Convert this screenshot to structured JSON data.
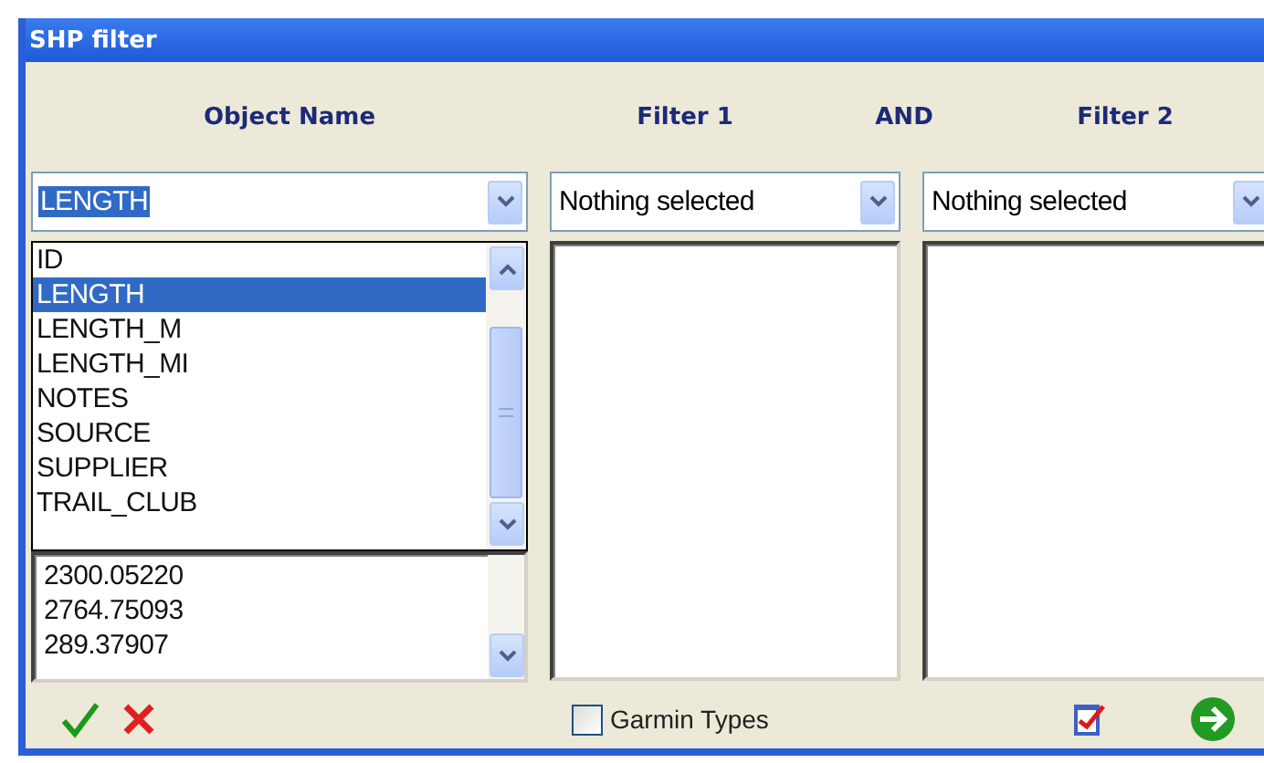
{
  "window": {
    "title": "SHP filter"
  },
  "headings": [
    "Object Name",
    "Filter 1",
    "AND",
    "Filter 2"
  ],
  "object_name": {
    "value": "LENGTH",
    "items": [
      {
        "label": "ID",
        "selected": false
      },
      {
        "label": "LENGTH",
        "selected": true
      },
      {
        "label": "LENGTH_M",
        "selected": false
      },
      {
        "label": "LENGTH_MI",
        "selected": false
      },
      {
        "label": "NOTES",
        "selected": false
      },
      {
        "label": "SOURCE",
        "selected": false
      },
      {
        "label": "SUPPLIER",
        "selected": false
      },
      {
        "label": "TRAIL_CLUB",
        "selected": false
      }
    ],
    "values": [
      "2300.05220",
      "2764.75093",
      "289.37907"
    ]
  },
  "filters": [
    {
      "value": "Nothing selected"
    },
    {
      "value": "Nothing selected"
    }
  ],
  "garmin_types": {
    "label": "Garmin Types",
    "checked": false
  }
}
